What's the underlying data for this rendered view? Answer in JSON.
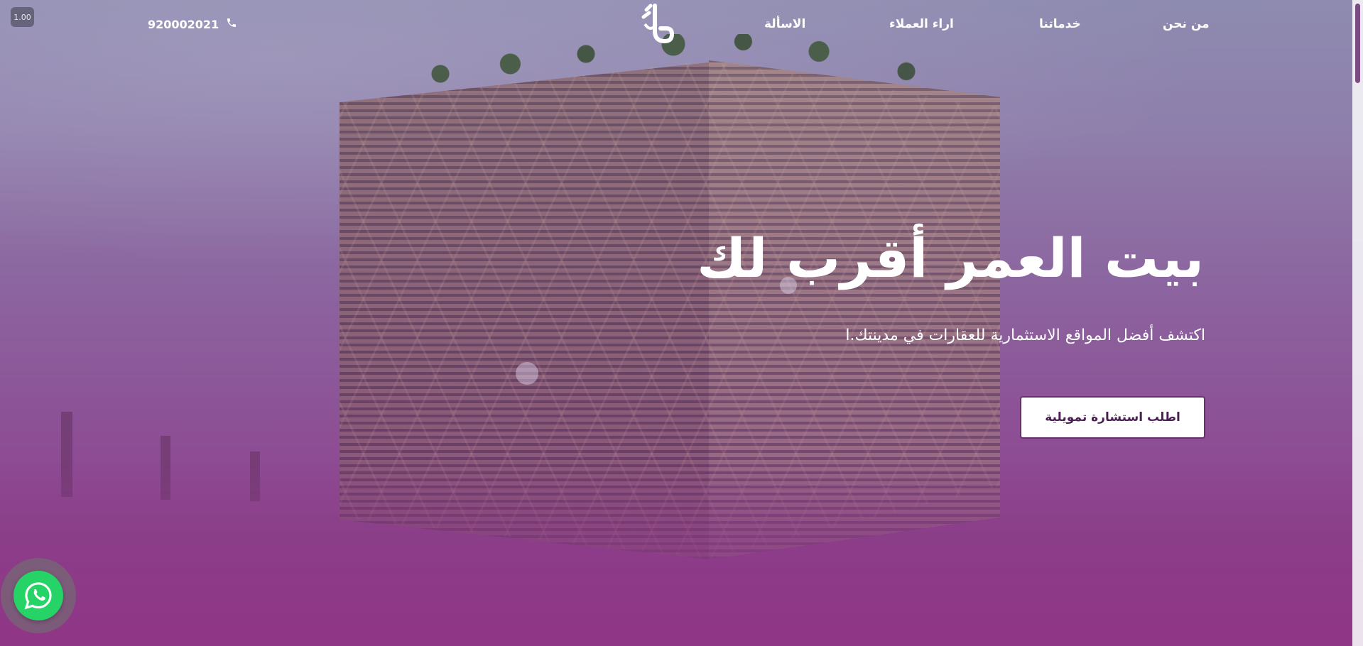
{
  "nav": {
    "items": [
      {
        "label": "من نحن"
      },
      {
        "label": "خدماتنا"
      },
      {
        "label": "اراء العملاء"
      },
      {
        "label": "الاسألة"
      }
    ],
    "phone": "920002021",
    "phone_icon": "phone-icon",
    "logo_icon": "brand-logo"
  },
  "badge": {
    "version": "1.00"
  },
  "hero": {
    "title": "بيت العمر أقرب لك",
    "subtitle": "اكتشف أفضل المواقع الاستثمارية للعقارات في مدينتك.ا",
    "cta_label": "اطلب استشارة تمويلية"
  },
  "floating": {
    "whatsapp_icon": "whatsapp-icon"
  },
  "colors": {
    "accent": "#6b2d6f",
    "whatsapp": "#25d366",
    "text_light": "#ffffff"
  }
}
